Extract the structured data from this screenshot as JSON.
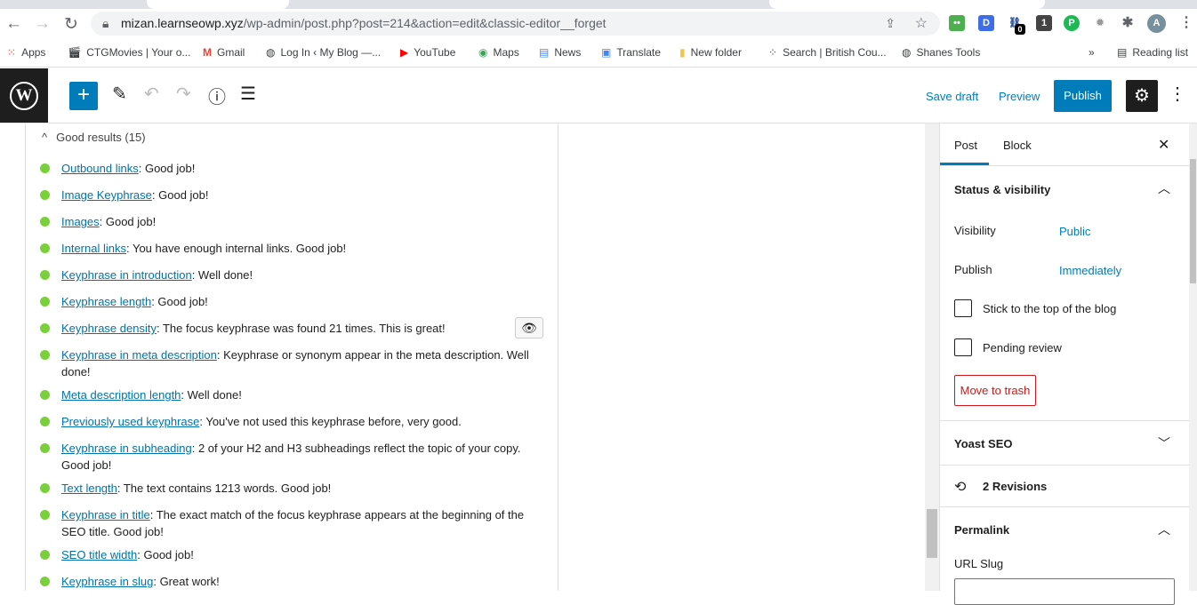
{
  "browser": {
    "url_host": "mizan.learnseowp.xyz",
    "url_path": "/wp-admin/post.php?post=214&action=edit&classic-editor__forget",
    "avatar_letter": "A",
    "ext_badge": "0",
    "bookmarks": [
      "Apps",
      "CTGMovies | Your o...",
      "Gmail",
      "Log In ‹ My Blog —...",
      "YouTube",
      "Maps",
      "News",
      "Translate",
      "New folder",
      "Search | British Cou...",
      "Shanes Tools"
    ],
    "more": "»",
    "reading_list": "Reading list"
  },
  "toolbar": {
    "save_draft": "Save draft",
    "preview": "Preview",
    "publish": "Publish"
  },
  "analysis": {
    "header": "Good results (15)",
    "items": [
      {
        "link": "Outbound links",
        "text": ": Good job!"
      },
      {
        "link": "Image Keyphrase",
        "text": ": Good job!"
      },
      {
        "link": "Images",
        "text": ": Good job!"
      },
      {
        "link": "Internal links",
        "text": ": You have enough internal links. Good job!"
      },
      {
        "link": "Keyphrase in introduction",
        "text": ": Well done!"
      },
      {
        "link": "Keyphrase length",
        "text": ": Good job!"
      },
      {
        "link": "Keyphrase density",
        "text": ": The focus keyphrase was found 21 times. This is great!"
      },
      {
        "link": "Keyphrase in meta description",
        "text": ": Keyphrase or synonym appear in the meta description. Well done!"
      },
      {
        "link": "Meta description length",
        "text": ": Well done!"
      },
      {
        "link": "Previously used keyphrase",
        "text": ": You've not used this keyphrase before, very good."
      },
      {
        "link": "Keyphrase in subheading",
        "text": ": 2 of your H2 and H3 subheadings reflect the topic of your copy. Good job!"
      },
      {
        "link": "Text length",
        "text": ": The text contains 1213 words. Good job!"
      },
      {
        "link": "Keyphrase in title",
        "text": ": The exact match of the focus keyphrase appears at the beginning of the SEO title. Good job!"
      },
      {
        "link": "SEO title width",
        "text": ": Good job!"
      },
      {
        "link": "Keyphrase in slug",
        "text": ": Great work!"
      }
    ]
  },
  "sidebar": {
    "tab_post": "Post",
    "tab_block": "Block",
    "status_title": "Status & visibility",
    "visibility_label": "Visibility",
    "visibility_value": "Public",
    "publish_label": "Publish",
    "publish_value": "Immediately",
    "sticky": "Stick to the top of the blog",
    "pending": "Pending review",
    "trash": "Move to trash",
    "yoast": "Yoast SEO",
    "revisions": "2 Revisions",
    "permalink": "Permalink",
    "url_slug": "URL Slug"
  }
}
